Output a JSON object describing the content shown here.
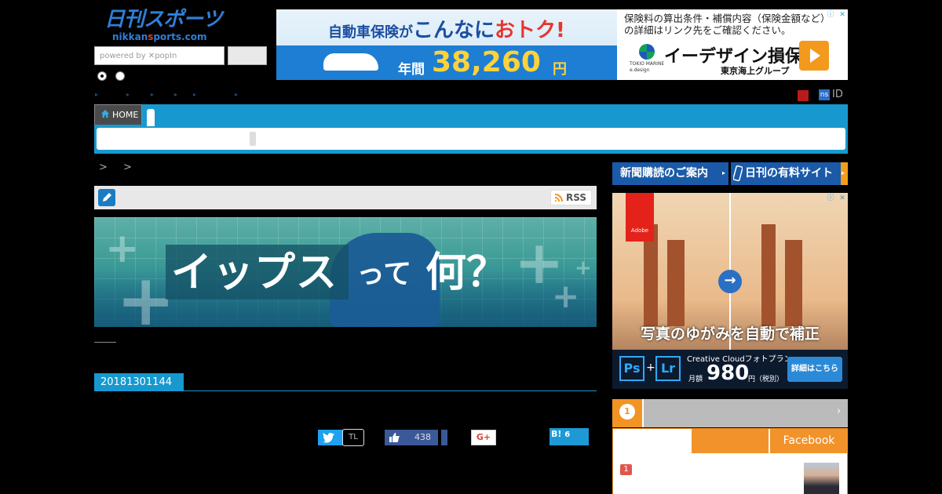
{
  "header": {
    "logo_main": "日刊スポーツ",
    "logo_sub_pre": "nikkan",
    "logo_sub_s": "s",
    "logo_sub_post": "ports.com",
    "search_placeholder": "powered by ✕popIn",
    "search_button": ""
  },
  "top_ad": {
    "line1_a": "自動車保険が",
    "line1_b": "こんなに",
    "line1_c": "おトク!",
    "nenkan": "年間",
    "price": "38,260",
    "yen": "円",
    "disclaimer": "保険料の算出条件・補償内容（保険金額など）の詳細はリンク先をご確認ください。",
    "brand_text": "TOKIO MARINE\ne.design",
    "name": "イーデザイン損保",
    "group": "東京海上グループ"
  },
  "nav": {
    "home_label": "HOME",
    "ns_badge": "ns",
    "id_label": "ID"
  },
  "breadcrumb": "> >",
  "section": {
    "rss_label": "RSS"
  },
  "hero": {
    "title_a": "イップス",
    "title_b": "って",
    "title_c": "何？"
  },
  "article": {
    "date_badge": "20181301144"
  },
  "share": {
    "tl_label": "TL",
    "fb_count": "438",
    "gplus_label": "G+",
    "hatena_label": "B!",
    "hatena_count": "6"
  },
  "sidebar": {
    "btn1": "新聞購読のご案内",
    "btn2": "日刊の有料サイト",
    "ad": {
      "adobe": "Adobe",
      "caption": "写真のゆがみを自動で補正",
      "ps": "Ps",
      "lr": "Lr",
      "plus": "+",
      "cc": "Creative Cloudフォトプラン",
      "getsu": "月額",
      "price": "980",
      "zei": "円（税別）",
      "cta": "詳細はこちら"
    },
    "rank_medal": "1",
    "rank_arrow": "›",
    "rank_tab_fb": "Facebook",
    "rank_num": "1"
  },
  "colors": {
    "accent_blue": "#1799cf",
    "orange": "#f2922a",
    "navy": "#1a5aa8"
  }
}
